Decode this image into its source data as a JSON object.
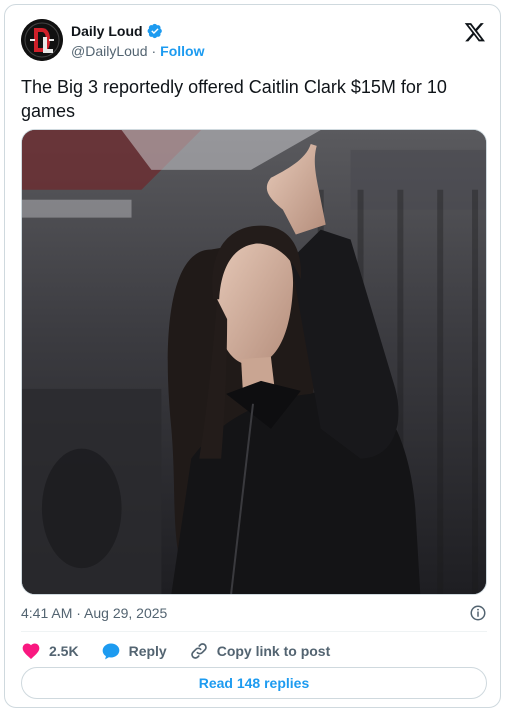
{
  "author": {
    "display_name": "Daily Loud",
    "handle": "@DailyLoud",
    "separator": "·",
    "follow_label": "Follow",
    "verified": true
  },
  "tweet": {
    "text": "The Big 3 reportedly offered Caitlin Clark $15M for 10 games",
    "timestamp": "4:41 AM · Aug 29, 2025"
  },
  "actions": {
    "like_count": "2.5K",
    "reply_label": "Reply",
    "copy_label": "Copy link to post"
  },
  "footer": {
    "read_replies_label": "Read 148 replies"
  },
  "colors": {
    "accent": "#1d9bf0",
    "like": "#f91880",
    "text_primary": "#0f1419",
    "text_secondary": "#536471",
    "border": "#cfd9de"
  },
  "icons": [
    "daily-loud-logo",
    "verified-badge-icon",
    "x-logo-icon",
    "info-icon",
    "heart-icon",
    "reply-icon",
    "link-icon"
  ]
}
